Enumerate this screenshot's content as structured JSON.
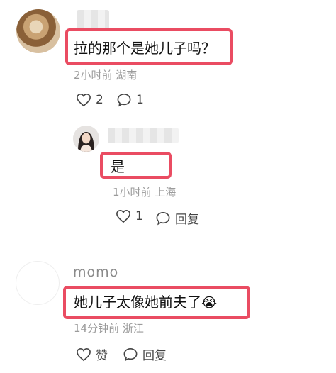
{
  "comments": [
    {
      "text": "拉的那个是她儿子吗？",
      "meta": "2小时前  湖南",
      "like_count": "2",
      "reply_count": "1"
    },
    {
      "text": "是",
      "meta": "1小时前  上海",
      "like_count": "1",
      "reply_label": "回复"
    },
    {
      "username": "momo",
      "text": "她儿子太像她前夫了",
      "emoji": "😭",
      "meta": "14分钟前  浙江",
      "like_label": "赞",
      "reply_label": "回复"
    }
  ],
  "colors": {
    "highlight": "#ea4c62",
    "meta": "#9b9b9b"
  }
}
